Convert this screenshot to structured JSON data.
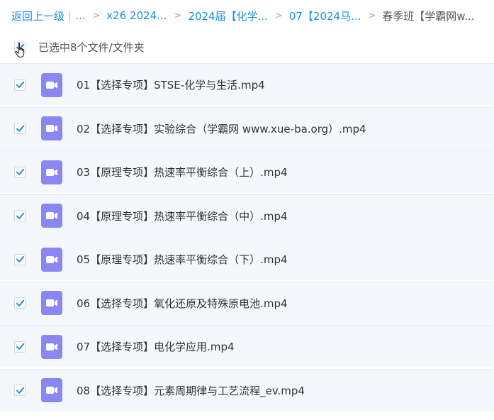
{
  "breadcrumb": {
    "back": "返回上一级",
    "dots": "...",
    "items": [
      "x26 2024...",
      "2024届【化学...",
      "07【2024马..."
    ],
    "current": "春季班【学霸网w..."
  },
  "selection": {
    "label": "已选中8个文件/文件夹"
  },
  "files": [
    {
      "name": "01【选择专项】STSE-化学与生活.mp4"
    },
    {
      "name": "02【选择专项】实验综合（学霸网 www.xue-ba.org）.mp4"
    },
    {
      "name": "03【原理专项】热速率平衡综合（上）.mp4"
    },
    {
      "name": "04【原理专项】热速率平衡综合（中）.mp4"
    },
    {
      "name": "05【原理专项】热速率平衡综合（下）.mp4"
    },
    {
      "name": "06【选择专项】氧化还原及特殊原电池.mp4"
    },
    {
      "name": "07【选择专项】电化学应用.mp4"
    },
    {
      "name": "08【选择专项】元素周期律与工艺流程_ev.mp4"
    }
  ],
  "colors": {
    "link": "#1a8ee8",
    "check": "#2a8fe6",
    "video_icon": "#8b87f2",
    "row_bg": "#f4f8fd"
  }
}
